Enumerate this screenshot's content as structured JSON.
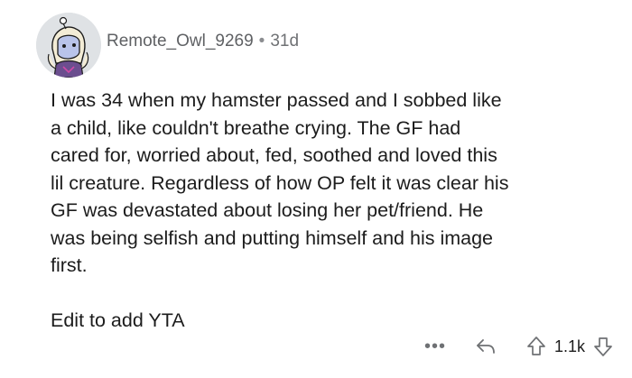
{
  "comment": {
    "username": "Remote_Owl_9269",
    "separator": "•",
    "age": "31d",
    "body_lines": [
      "I was 34 when my hamster passed and I sobbed like",
      "a child, like couldn't breathe crying. The GF had",
      "cared for,  worried about, fed, soothed and loved this",
      "lil creature. Regardless of how OP felt it was clear his",
      "GF was devastated about losing her pet/friend.  He",
      "was  being selfish and putting himself and his image",
      "first."
    ],
    "edit_note": "Edit to add YTA"
  },
  "actions": {
    "more_label": "•••",
    "score": "1.1k",
    "icons": [
      "more-icon",
      "reply-icon",
      "upvote-icon",
      "downvote-icon"
    ]
  },
  "colors": {
    "text": "#1c1c1c",
    "meta": "#6f7174",
    "avatar_bg": "#dfe2e5"
  }
}
